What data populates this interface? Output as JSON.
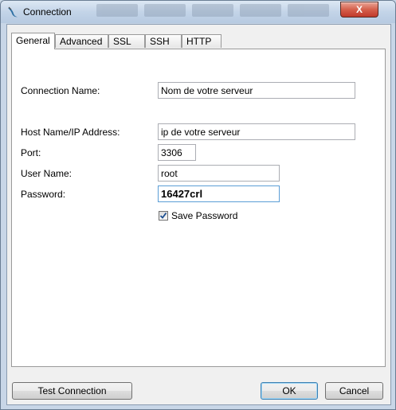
{
  "window": {
    "title": "Connection",
    "icon": "dolphin-icon",
    "close_label": "X"
  },
  "tabs": [
    {
      "label": "General",
      "active": true
    },
    {
      "label": "Advanced",
      "active": false
    },
    {
      "label": "SSL",
      "active": false
    },
    {
      "label": "SSH",
      "active": false
    },
    {
      "label": "HTTP",
      "active": false
    }
  ],
  "form": {
    "connection_name_label": "Connection Name:",
    "connection_name_value": "Nom de votre serveur",
    "host_label": "Host Name/IP Address:",
    "host_value": "ip de votre serveur",
    "port_label": "Port:",
    "port_value": "3306",
    "user_label": "User Name:",
    "user_value": "root",
    "password_label": "Password:",
    "password_value": "16427crl",
    "save_password_label": "Save Password",
    "save_password_checked": true
  },
  "buttons": {
    "test_connection": "Test Connection",
    "ok": "OK",
    "cancel": "Cancel"
  }
}
